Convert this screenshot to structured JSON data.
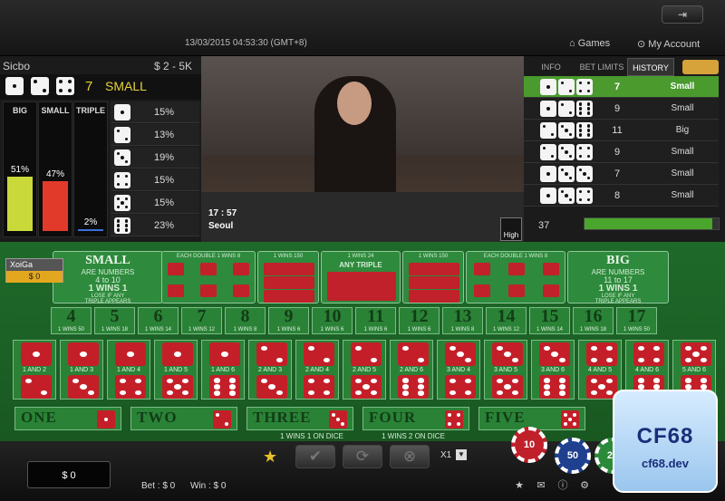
{
  "header": {
    "datetime": "13/03/2015 04:53:30 (GMT+8)",
    "games_label": "Games",
    "account_label": "My Account"
  },
  "game": {
    "name": "Sicbo",
    "limits": "$ 2 - 5K",
    "last_result": {
      "dice": [
        1,
        2,
        4
      ],
      "total": "7",
      "label": "SMALL"
    }
  },
  "stats": {
    "bars": [
      {
        "label": "BIG",
        "pct": "51%",
        "value": 51,
        "color": "#c9d93a"
      },
      {
        "label": "SMALL",
        "pct": "47%",
        "value": 47,
        "color": "#e23a2a"
      },
      {
        "label": "TRIPLE",
        "pct": "2%",
        "value": 2,
        "color": "#3a6fd9"
      }
    ],
    "faces": [
      {
        "face": 1,
        "pct": "15%"
      },
      {
        "face": 2,
        "pct": "13%"
      },
      {
        "face": 3,
        "pct": "19%"
      },
      {
        "face": 4,
        "pct": "15%"
      },
      {
        "face": 5,
        "pct": "15%"
      },
      {
        "face": 6,
        "pct": "23%"
      }
    ]
  },
  "video": {
    "time": "17 : 57",
    "city": "Seoul",
    "quality_label": "High"
  },
  "history_panel": {
    "tabs": [
      "INFO",
      "BET LIMITS",
      "HISTORY"
    ],
    "active_tab": "HISTORY",
    "rows": [
      {
        "dice": [
          1,
          2,
          4
        ],
        "total": "7",
        "label": "Small"
      },
      {
        "dice": [
          1,
          2,
          6
        ],
        "total": "9",
        "label": "Small"
      },
      {
        "dice": [
          2,
          3,
          6
        ],
        "total": "11",
        "label": "Big"
      },
      {
        "dice": [
          2,
          3,
          4
        ],
        "total": "9",
        "label": "Small"
      },
      {
        "dice": [
          1,
          3,
          3
        ],
        "total": "7",
        "label": "Small"
      },
      {
        "dice": [
          1,
          3,
          4
        ],
        "total": "8",
        "label": "Small"
      }
    ],
    "round_number": "37",
    "timer_progress": 0.95
  },
  "board": {
    "small": {
      "title": "SMALL",
      "lines": [
        "ARE NUMBERS",
        "4 to 10",
        "1 WINS 1",
        "LOSE IF ANY",
        "TRIPLE APPEARS"
      ]
    },
    "big": {
      "title": "BIG",
      "lines": [
        "ARE NUMBERS",
        "11 to 17",
        "1 WINS 1",
        "LOSE IF ANY",
        "TRIPLE APPEARS"
      ]
    },
    "double_header_left": "EACH DOUBLE 1 WINS 8",
    "double_header_right": "EACH DOUBLE 1 WINS 8",
    "triple_header_left": "1 WINS 150",
    "triple_header_right": "1 WINS 150",
    "any_triple_header": "1 WINS 24",
    "any_triple_label": "ANY TRIPLE",
    "numbers": [
      {
        "n": "4",
        "pay": "1 WINS 50"
      },
      {
        "n": "5",
        "pay": "1 WINS 18"
      },
      {
        "n": "6",
        "pay": "1 WINS 14"
      },
      {
        "n": "7",
        "pay": "1 WINS 12"
      },
      {
        "n": "8",
        "pay": "1 WINS 8"
      },
      {
        "n": "9",
        "pay": "1 WINS 6"
      },
      {
        "n": "10",
        "pay": "1 WINS 6"
      },
      {
        "n": "11",
        "pay": "1 WINS 6"
      },
      {
        "n": "12",
        "pay": "1 WINS 6"
      },
      {
        "n": "13",
        "pay": "1 WINS 8"
      },
      {
        "n": "14",
        "pay": "1 WINS 12"
      },
      {
        "n": "15",
        "pay": "1 WINS 14"
      },
      {
        "n": "16",
        "pay": "1 WINS 18"
      },
      {
        "n": "17",
        "pay": "1 WINS 50"
      }
    ],
    "combos": [
      "1 AND 2",
      "1 AND 3",
      "1 AND 4",
      "1 AND 5",
      "1 AND 6",
      "2 AND 3",
      "2 AND 4",
      "2 AND 5",
      "2 AND 6",
      "3 AND 4",
      "3 AND 5",
      "3 AND 6",
      "4 AND 5",
      "4 AND 6",
      "5 AND 6"
    ],
    "singles": [
      {
        "word": "ONE",
        "face": 1
      },
      {
        "word": "TWO",
        "face": 2
      },
      {
        "word": "THREE",
        "face": 3
      },
      {
        "word": "FOUR",
        "face": 4
      },
      {
        "word": "FIVE",
        "face": 5
      }
    ],
    "singles_footer": "1 WINS 1 ON DICE",
    "singles_footer2": "1 WINS 2 ON DICE"
  },
  "player": {
    "name": "XoiGa",
    "balance": "$ 0"
  },
  "footer": {
    "balance": "$ 0",
    "bet_label": "Bet : $ 0",
    "win_label": "Win : $ 0",
    "multiplier": "X1",
    "chips": [
      {
        "value": "10",
        "color": "#c0202a"
      },
      {
        "value": "50",
        "color": "#1f3f8f"
      },
      {
        "value": "20",
        "color": "#2b8a3a"
      }
    ]
  },
  "watermark": {
    "brand": "CF68",
    "url": "cf68.dev"
  }
}
